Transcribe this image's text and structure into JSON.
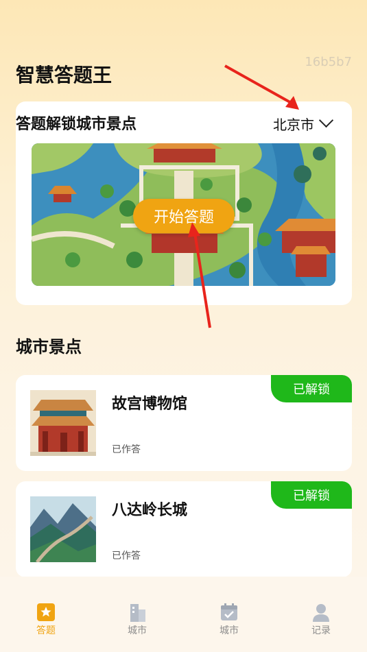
{
  "watermark": "16b5b7",
  "header": {
    "title": "智慧答题王"
  },
  "quiz_card": {
    "title": "答题解锁城市景点",
    "city": "北京市",
    "start_label": "开始答题"
  },
  "section": {
    "title": "城市景点"
  },
  "spots": [
    {
      "name": "故宫博物馆",
      "status": "已作答",
      "badge": "已解锁"
    },
    {
      "name": "八达岭长城",
      "status": "已作答",
      "badge": "已解锁"
    }
  ],
  "tabs": [
    {
      "label": "答题",
      "icon": "star-icon",
      "active": true
    },
    {
      "label": "城市",
      "icon": "buildings-icon",
      "active": false
    },
    {
      "label": "城市",
      "icon": "calendar-check-icon",
      "active": false
    },
    {
      "label": "记录",
      "icon": "user-icon",
      "active": false
    }
  ],
  "colors": {
    "accent": "#f0a412",
    "unlock": "#1fb81a",
    "annotation": "#e8241c"
  }
}
